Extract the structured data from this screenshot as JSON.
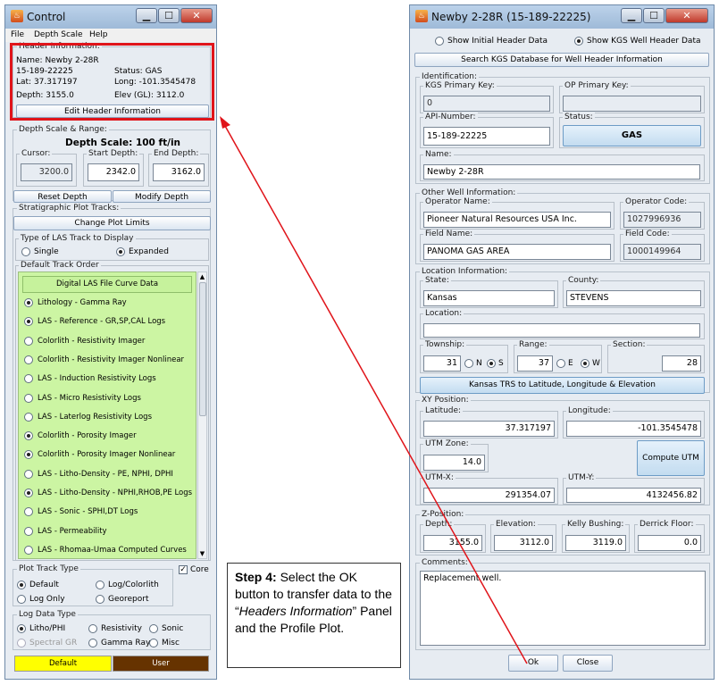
{
  "control": {
    "title": "Control",
    "menu": [
      "File",
      "Depth Scale",
      "Help"
    ],
    "header": {
      "legend": "Header Information:",
      "name": "Name: Newby 2-28R",
      "api": "15-189-22225",
      "status": "Status: GAS",
      "lat": "Lat: 37.317197",
      "long": "Long: -101.3545478",
      "depth": "Depth: 3155.0",
      "elev": "Elev (GL): 3112.0",
      "edit_button": "Edit Header Information"
    },
    "depth": {
      "legend": "Depth Scale & Range:",
      "scale": "Depth Scale: 100 ft/in",
      "cursor_label": "Cursor:",
      "cursor": "3200.0",
      "start_label": "Start Depth:",
      "start": "2342.0",
      "end_label": "End Depth:",
      "end": "3162.0",
      "reset": "Reset Depth",
      "modify": "Modify Depth"
    },
    "tracks": {
      "legend": "Stratigraphic Plot Tracks:",
      "change": "Change Plot Limits",
      "type_legend": "Type of LAS Track to Display",
      "single": "Single",
      "expanded": "Expanded",
      "order_legend": "Default Track Order",
      "digital": "Digital LAS File Curve Data",
      "items": [
        "Lithology - Gamma Ray",
        "LAS - Reference - GR,SP,CAL Logs",
        "Colorlith - Resistivity Imager",
        "Colorlith - Resistivity Imager Nonlinear",
        "LAS - Induction Resistivity Logs",
        "LAS - Micro Resistivity Logs",
        "LAS - Laterlog Resistivity Logs",
        "Colorlith - Porosity Imager",
        "Colorlith - Porosity Imager Nonlinear",
        "LAS - Litho-Density - PE, NPHI, DPHI",
        "LAS - Litho-Density - NPHI,RHOB,PE Logs",
        "LAS - Sonic - SPHI,DT Logs",
        "LAS - Permeability",
        "LAS - Rhomaa-Umaa Computed Curves"
      ],
      "selected": [
        true,
        true,
        false,
        false,
        false,
        false,
        false,
        true,
        true,
        false,
        true,
        false,
        false,
        false
      ]
    },
    "plot_type": {
      "legend": "Plot Track Type",
      "core": "Core",
      "default": "Default",
      "logcolor": "Log/Colorlith",
      "logonly": "Log Only",
      "georeport": "Georeport"
    },
    "log_type": {
      "legend": "Log Data Type",
      "litho": "Litho/PHI",
      "resist": "Resistivity",
      "sonic": "Sonic",
      "spectral": "Spectral GR",
      "gamma": "Gamma Ray",
      "misc": "Misc"
    },
    "footer": {
      "default": "Default",
      "user": "User"
    }
  },
  "newby": {
    "title": "Newby 2-28R (15-189-22225)",
    "show_initial": "Show Initial Header Data",
    "show_kgs": "Show KGS Well Header Data",
    "search": "Search KGS Database for Well Header Information",
    "ident": {
      "legend": "Identification:",
      "kgs_label": "KGS Primary Key:",
      "kgs": "0",
      "op_label": "OP Primary Key:",
      "op": "",
      "api_label": "API-Number:",
      "api": "15-189-22225",
      "status_label": "Status:",
      "status": "GAS",
      "name_label": "Name:",
      "name": "Newby 2-28R"
    },
    "other": {
      "legend": "Other Well Information:",
      "operator_label": "Operator Name:",
      "operator": "Pioneer Natural Resources USA Inc.",
      "opcode_label": "Operator Code:",
      "opcode": "1027996936",
      "field_label": "Field Name:",
      "field": "PANOMA GAS AREA",
      "fcode_label": "Field Code:",
      "fcode": "1000149964"
    },
    "loc": {
      "legend": "Location Information:",
      "state_label": "State:",
      "state": "Kansas",
      "county_label": "County:",
      "county": "STEVENS",
      "location_label": "Location:",
      "location": "",
      "twp_label": "Township:",
      "twp": "31",
      "n": "N",
      "s": "S",
      "rng_label": "Range:",
      "rng": "37",
      "e": "E",
      "w": "W",
      "sec_label": "Section:",
      "sec": "28",
      "trs": "Kansas TRS to Latitude, Longitude & Elevation"
    },
    "xy": {
      "legend": "XY Position:",
      "lat_label": "Latitude:",
      "lat": "37.317197",
      "lon_label": "Longitude:",
      "lon": "-101.3545478",
      "zone_label": "UTM Zone:",
      "zone": "14.0",
      "compute": "Compute UTM",
      "utmx_label": "UTM-X:",
      "utmx": "291354.07",
      "utmy_label": "UTM-Y:",
      "utmy": "4132456.82"
    },
    "z": {
      "legend": "Z-Position:",
      "depth_label": "Depth:",
      "depth": "3155.0",
      "elev_label": "Elevation:",
      "elev": "3112.0",
      "kb_label": "Kelly Bushing:",
      "kb": "3119.0",
      "df_label": "Derrick Floor:",
      "df": "0.0"
    },
    "comments": {
      "legend": "Comments:",
      "text": "Replacement well."
    },
    "ok": "Ok",
    "close": "Close"
  },
  "callout": {
    "step": "Step 4:",
    "line1": " Select the OK button to transfer data to the “",
    "italic": "Headers Information",
    "line2": "” Panel and the Profile Plot."
  },
  "colors": {
    "highlight": "#e0141a",
    "green": "#ccf5a3",
    "default_btn": "#ffff00",
    "user_btn": "#663300"
  }
}
